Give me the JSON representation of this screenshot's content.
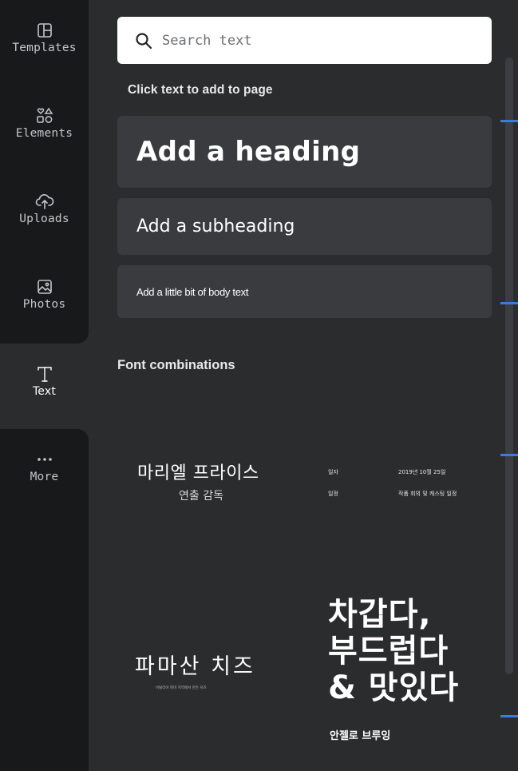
{
  "rail": {
    "items": [
      {
        "label": "Templates",
        "icon": "templates-icon"
      },
      {
        "label": "Elements",
        "icon": "elements-icon"
      },
      {
        "label": "Uploads",
        "icon": "upload-cloud-icon"
      },
      {
        "label": "Photos",
        "icon": "photo-icon"
      },
      {
        "label": "Text",
        "icon": "text-icon"
      },
      {
        "label": "More",
        "icon": "more-dots-icon"
      }
    ],
    "active": "Text"
  },
  "search": {
    "placeholder": "Search text"
  },
  "hint": "Click text to add to page",
  "buttons": {
    "heading": "Add a heading",
    "subheading": "Add a subheading",
    "body": "Add a little bit of body text"
  },
  "font_combinations": {
    "title": "Font combinations",
    "items": [
      {
        "title": "마리엘 프라이스",
        "subtitle": "연출 감독"
      },
      {
        "rows": [
          {
            "key": "일자",
            "value": "2019년 10월 25일"
          },
          {
            "key": "일정",
            "value": "작품 회의 및 캐스팅 일정"
          }
        ]
      },
      {
        "title": "파마산 치즈",
        "subtitle": "이탈리아 파마 지역에서 만든 치즈"
      },
      {
        "lines": [
          "차갑다,",
          "부드럽다",
          "& 맛있다"
        ],
        "subtitle": "안젤로 브루잉"
      }
    ]
  },
  "colors": {
    "rail_bg": "#18191b",
    "panel_bg": "#2b2c2e",
    "button_bg": "#3a3b3e",
    "accent": "#3b7be0"
  }
}
